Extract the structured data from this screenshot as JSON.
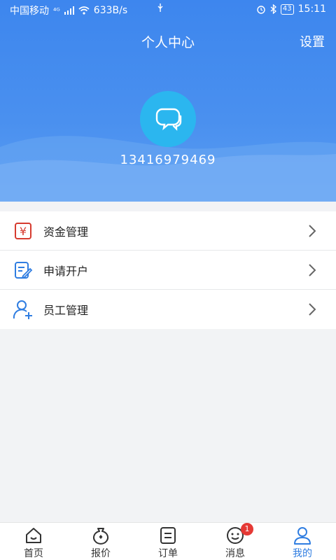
{
  "status_bar": {
    "carrier": "中国移动",
    "network": "⁴ᴳ",
    "speed": "633B/s",
    "battery": "43",
    "time": "15:11"
  },
  "header": {
    "title": "个人中心",
    "settings_label": "设置",
    "phone": "13416979469"
  },
  "menu": {
    "items": [
      {
        "label": "资金管理",
        "icon": "yuan-icon"
      },
      {
        "label": "申请开户",
        "icon": "edit-doc-icon"
      },
      {
        "label": "员工管理",
        "icon": "add-user-icon"
      }
    ]
  },
  "tabbar": {
    "tabs": [
      {
        "label": "首页",
        "icon": "home-icon"
      },
      {
        "label": "报价",
        "icon": "money-bag-icon"
      },
      {
        "label": "订单",
        "icon": "order-list-icon"
      },
      {
        "label": "消息",
        "icon": "smile-icon",
        "badge": "1"
      },
      {
        "label": "我的",
        "icon": "user-icon",
        "active": true
      }
    ]
  },
  "colors": {
    "primary": "#3d86ee",
    "avatar_bg": "#2bb6ef",
    "active_tab": "#2f7de1",
    "badge": "#e53935"
  }
}
